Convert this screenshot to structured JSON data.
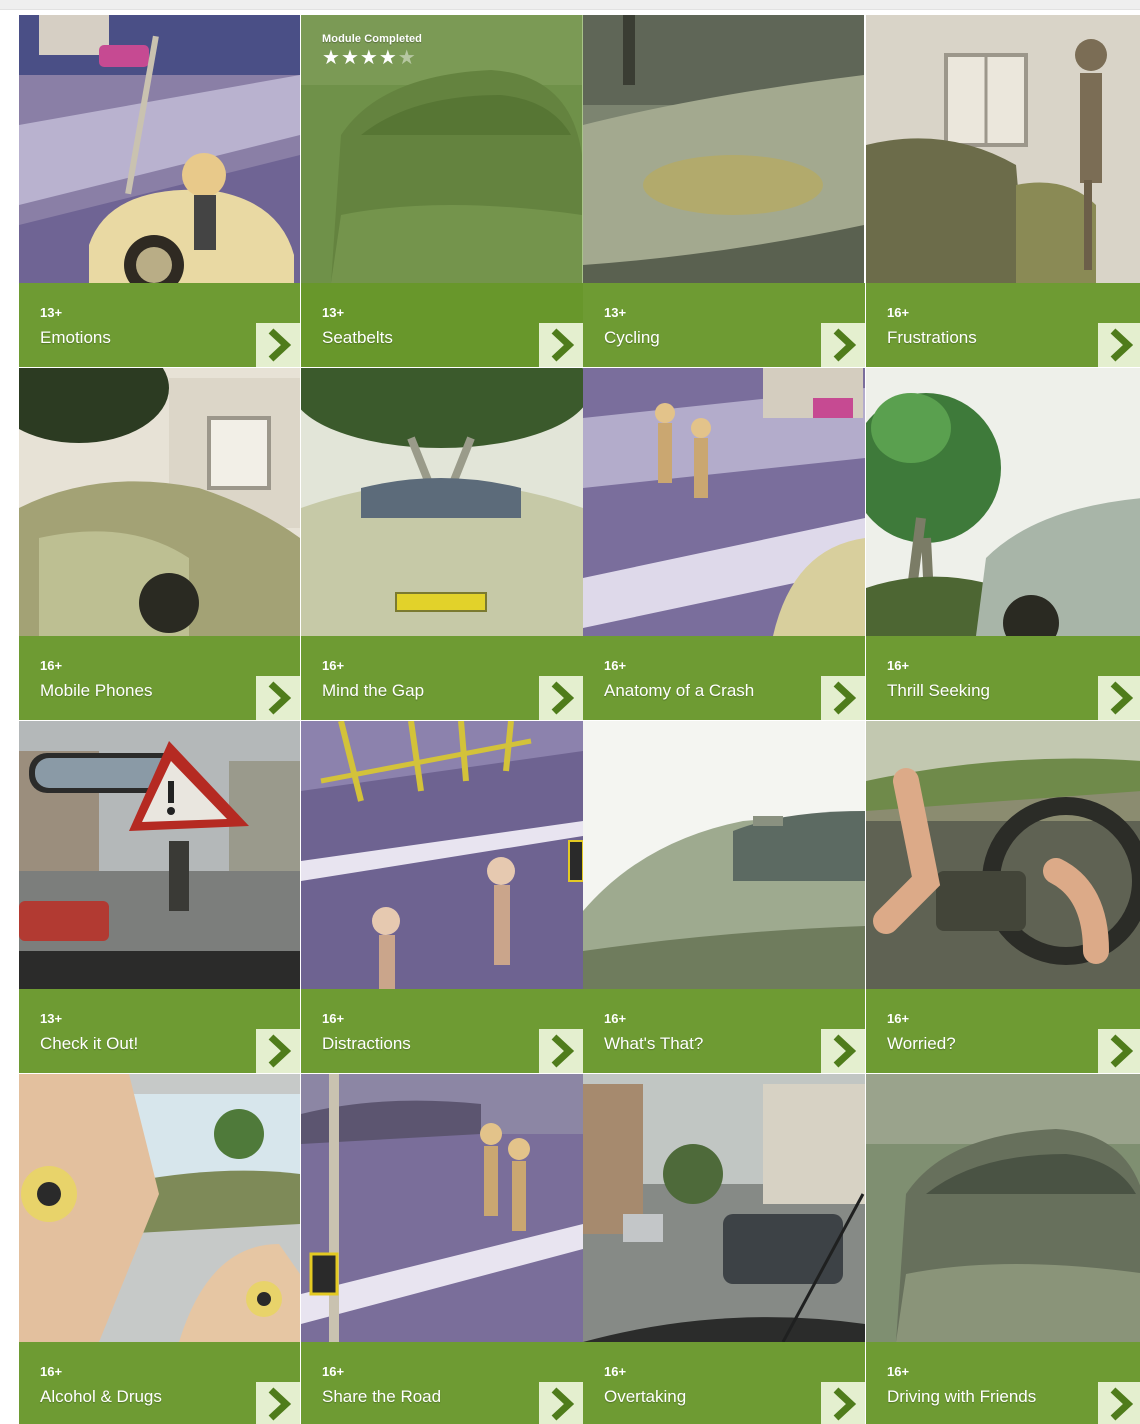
{
  "colors": {
    "band": "#639324",
    "arrow_bg": "#e4efcf",
    "arrow": "#4f7c1b"
  },
  "modules": [
    {
      "age": "13+",
      "title": "Emotions",
      "scene": "street-dummy-car",
      "completed": false
    },
    {
      "age": "13+",
      "title": "Seatbelts",
      "scene": "car-front",
      "completed": true,
      "completed_label": "Module Completed",
      "rating": 4,
      "rating_max": 5
    },
    {
      "age": "13+",
      "title": "Cycling",
      "scene": "car-hood",
      "completed": false
    },
    {
      "age": "16+",
      "title": "Frustrations",
      "scene": "house-dummy-door",
      "completed": false
    },
    {
      "age": "16+",
      "title": "Mobile Phones",
      "scene": "house-car-side",
      "completed": false
    },
    {
      "age": "16+",
      "title": "Mind the Gap",
      "scene": "car-rear-tree",
      "completed": false
    },
    {
      "age": "16+",
      "title": "Anatomy of a Crash",
      "scene": "street-dummies",
      "completed": false
    },
    {
      "age": "16+",
      "title": "Thrill Seeking",
      "scene": "tree-car",
      "completed": false
    },
    {
      "age": "13+",
      "title": "Check it Out!",
      "scene": "mirror-warning",
      "completed": false
    },
    {
      "age": "16+",
      "title": "Distractions",
      "scene": "junction-dummies",
      "completed": false
    },
    {
      "age": "16+",
      "title": "What's That?",
      "scene": "car-side-white",
      "completed": false
    },
    {
      "age": "16+",
      "title": "Worried?",
      "scene": "steering-wheel",
      "completed": false
    },
    {
      "age": "16+",
      "title": "Alcohol & Drugs",
      "scene": "dummy-hands-car",
      "completed": false
    },
    {
      "age": "16+",
      "title": "Share the Road",
      "scene": "street-dummies-2",
      "completed": false
    },
    {
      "age": "16+",
      "title": "Overtaking",
      "scene": "town-street",
      "completed": false
    },
    {
      "age": "16+",
      "title": "Driving with Friends",
      "scene": "car-front",
      "completed": false
    }
  ]
}
